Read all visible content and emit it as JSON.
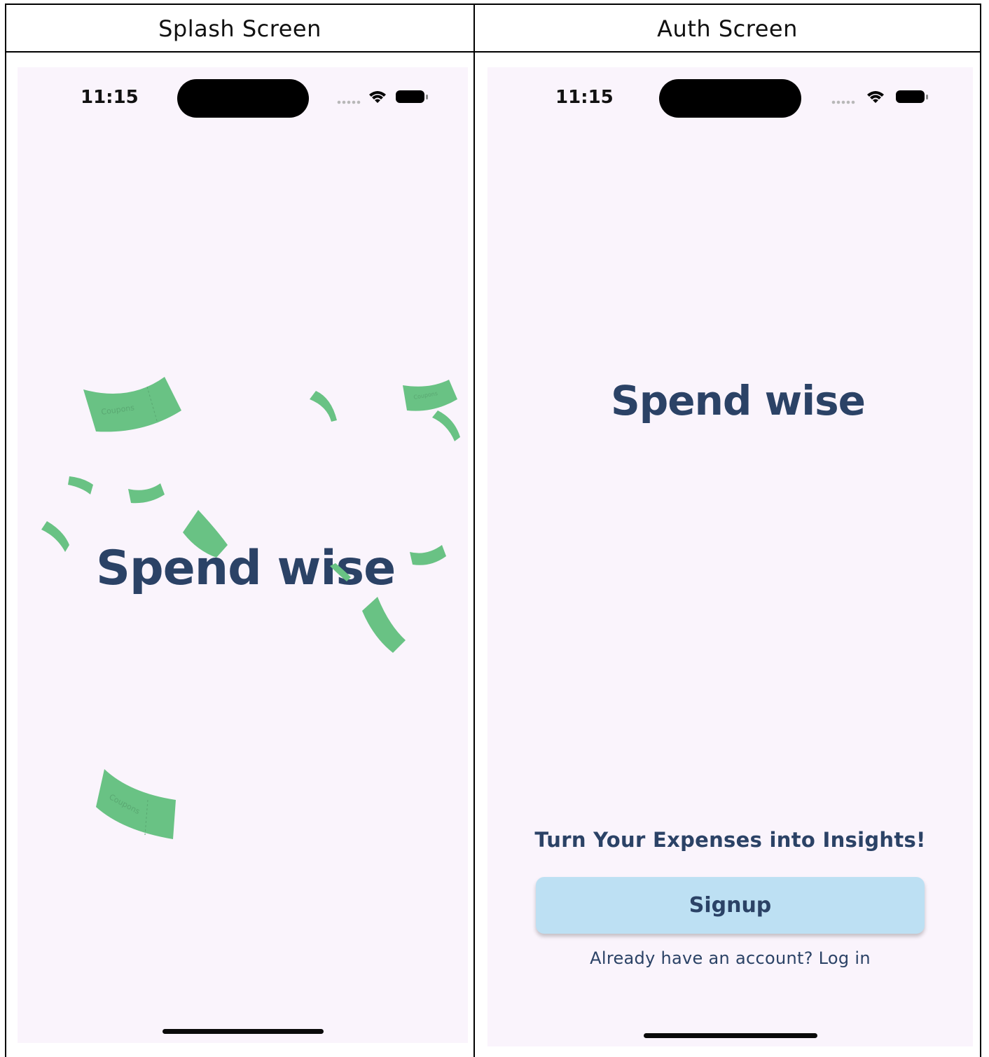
{
  "columns": {
    "left_title": "Splash Screen",
    "right_title": "Auth Screen"
  },
  "splash": {
    "status_time": "11:15",
    "brand": "Spend wise",
    "coupon_text": "Coupons",
    "coupon_color": "#69c284"
  },
  "auth": {
    "status_time": "11:15",
    "brand": "Spend wise",
    "tagline": "Turn Your Expenses into Insights!",
    "signup_label": "Signup",
    "login_text": "Already have an account? Log in"
  },
  "colors": {
    "background": "#faf4fc",
    "brand": "#2b4266",
    "button": "#bde0f3"
  },
  "icons": {
    "signal": "signal-dots-icon",
    "wifi": "wifi-icon",
    "battery": "battery-icon"
  }
}
